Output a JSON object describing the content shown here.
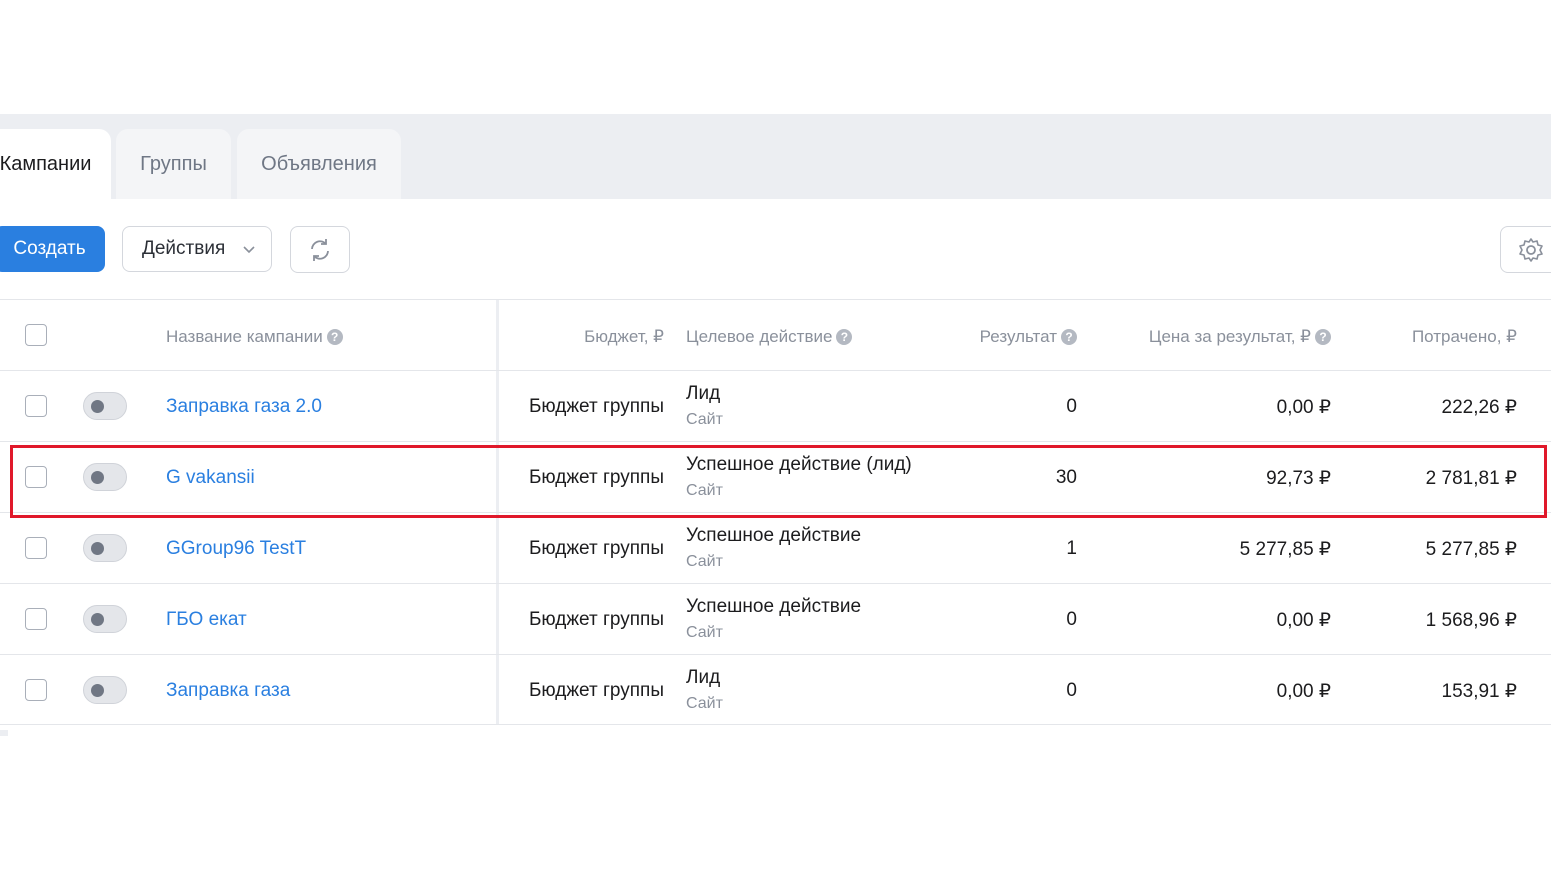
{
  "tabs": [
    {
      "label": "Кампании",
      "active": true
    },
    {
      "label": "Группы",
      "active": false
    },
    {
      "label": "Объявления",
      "active": false
    }
  ],
  "toolbar": {
    "create_label": "Создать",
    "actions_label": "Действия",
    "refresh_icon": "refresh-icon",
    "settings_icon": "gear-icon"
  },
  "table": {
    "headers": {
      "name": "Название кампании",
      "budget": "Бюджет, ₽",
      "target": "Целевое действие",
      "result": "Результат",
      "cost_per_result": "Цена за результат, ₽",
      "spent": "Потрачено, ₽"
    },
    "rows": [
      {
        "name": "Заправка газа 2.0",
        "budget": "Бюджет группы",
        "target": "Лид",
        "target_sub": "Сайт",
        "result": "0",
        "cost_per_result": "0,00 ₽",
        "spent": "222,26 ₽"
      },
      {
        "name": "G vakansii",
        "budget": "Бюджет группы",
        "target": "Успешное действие (лид)",
        "target_sub": "Сайт",
        "result": "30",
        "cost_per_result": "92,73 ₽",
        "spent": "2 781,81 ₽"
      },
      {
        "name": "GGroup96 TestT",
        "budget": "Бюджет группы",
        "target": "Успешное действие",
        "target_sub": "Сайт",
        "result": "1",
        "cost_per_result": "5 277,85 ₽",
        "spent": "5 277,85 ₽"
      },
      {
        "name": "ГБО екат",
        "budget": "Бюджет группы",
        "target": "Успешное действие",
        "target_sub": "Сайт",
        "result": "0",
        "cost_per_result": "0,00 ₽",
        "spent": "1 568,96 ₽"
      },
      {
        "name": "Заправка газа",
        "budget": "Бюджет группы",
        "target": "Лид",
        "target_sub": "Сайт",
        "result": "0",
        "cost_per_result": "0,00 ₽",
        "spent": "153,91 ₽"
      }
    ]
  },
  "colors": {
    "accent": "#2a7fe0",
    "highlight": "#e0182a"
  }
}
